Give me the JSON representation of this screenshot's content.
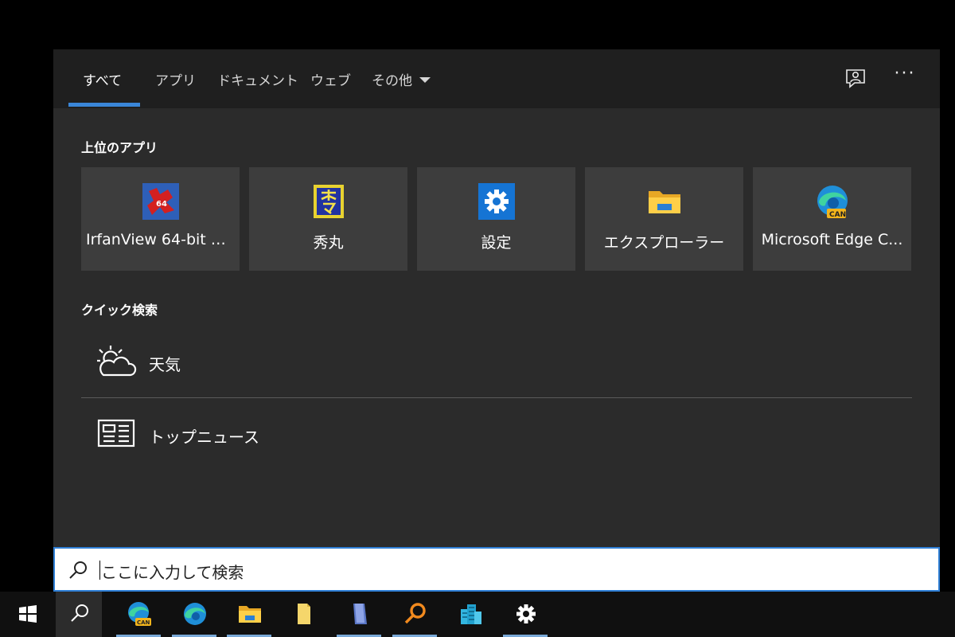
{
  "nav": {
    "tabs": [
      {
        "label": "すべて"
      },
      {
        "label": "アプリ"
      },
      {
        "label": "ドキュメント"
      },
      {
        "label": "ウェブ"
      },
      {
        "label": "その他"
      }
    ],
    "more_label": "···",
    "feedback_icon": "feedback-icon",
    "accent": "#3a86d8"
  },
  "top_apps": {
    "title": "上位のアプリ",
    "items": [
      {
        "label": "IrfanView 64-bit A...",
        "icon": "irfanview-icon"
      },
      {
        "label": "秀丸",
        "icon": "hidemaru-icon"
      },
      {
        "label": "設定",
        "icon": "settings-icon"
      },
      {
        "label": "エクスプローラー",
        "icon": "explorer-folder-icon"
      },
      {
        "label": "Microsoft Edge C...",
        "icon": "edge-canary-icon"
      }
    ]
  },
  "quick_search": {
    "title": "クイック検索",
    "items": [
      {
        "label": "天気",
        "icon": "weather-icon"
      },
      {
        "label": "トップニュース",
        "icon": "news-icon"
      }
    ]
  },
  "search": {
    "text": "ここに入力して検索",
    "icon": "search-icon"
  },
  "taskbar": {
    "items": [
      {
        "name": "start-button",
        "icon": "windows-logo-icon"
      },
      {
        "name": "search-button",
        "icon": "search-icon"
      },
      {
        "name": "edge-canary",
        "icon": "edge-canary-icon",
        "badge": "CAN"
      },
      {
        "name": "edge",
        "icon": "edge-icon"
      },
      {
        "name": "file-explorer",
        "icon": "folder-icon"
      },
      {
        "name": "notes-app",
        "icon": "yellow-file-icon"
      },
      {
        "name": "document-app",
        "icon": "blue-document-icon"
      },
      {
        "name": "search-app",
        "icon": "orange-magnifier-icon"
      },
      {
        "name": "buildings-app",
        "icon": "buildings-icon"
      },
      {
        "name": "settings",
        "icon": "gear-icon"
      }
    ]
  }
}
